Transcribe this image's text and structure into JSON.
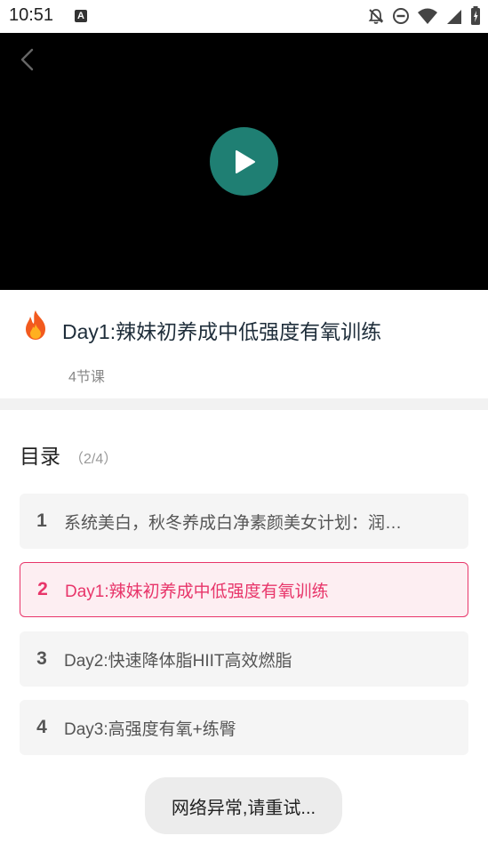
{
  "status_bar": {
    "time": "10:51",
    "notification_badge": "A",
    "icons": [
      "notifications-off-icon",
      "do-not-disturb-icon",
      "wifi-icon",
      "cell-signal-icon",
      "battery-icon"
    ]
  },
  "video": {
    "back_icon": "chevron-left-icon",
    "play_icon": "play-icon",
    "play_button_color": "#1f7f73"
  },
  "course": {
    "icon": "fire-icon",
    "title": "Day1:辣妹初养成中低强度有氧训练",
    "lesson_count": "4节课"
  },
  "toc": {
    "title": "目录",
    "progress": "（2/4）",
    "items": [
      {
        "num": "1",
        "label": "系统美白，秋冬养成白净素颜美女计划：润…",
        "active": false
      },
      {
        "num": "2",
        "label": "Day1:辣妹初养成中低强度有氧训练",
        "active": true
      },
      {
        "num": "3",
        "label": "Day2:快速降体脂HIIT高效燃脂",
        "active": false
      },
      {
        "num": "4",
        "label": "Day3:高强度有氧+练臀",
        "active": false
      }
    ],
    "active_color": "#e8356a"
  },
  "toast": {
    "message": "网络异常,请重试..."
  }
}
